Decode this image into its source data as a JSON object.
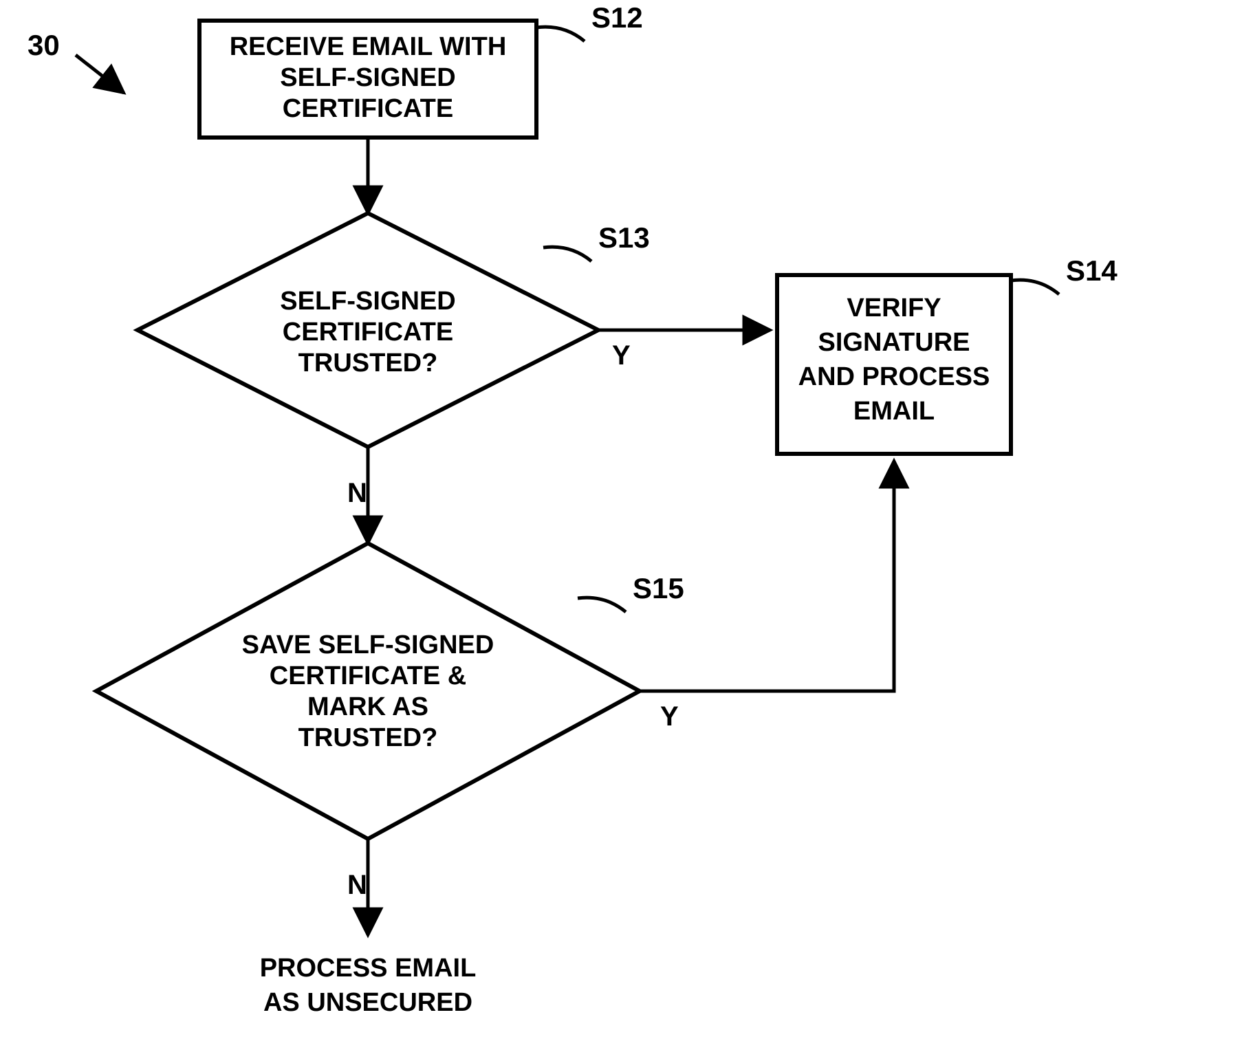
{
  "diagram": {
    "figure_label": "30",
    "nodes": {
      "s12": {
        "ref": "S12",
        "line1": "RECEIVE EMAIL WITH",
        "line2": "SELF-SIGNED",
        "line3": "CERTIFICATE"
      },
      "s13": {
        "ref": "S13",
        "line1": "SELF-SIGNED",
        "line2": "CERTIFICATE",
        "line3": "TRUSTED?"
      },
      "s14": {
        "ref": "S14",
        "line1": "VERIFY",
        "line2": "SIGNATURE",
        "line3": "AND PROCESS",
        "line4": "EMAIL"
      },
      "s15": {
        "ref": "S15",
        "line1": "SAVE SELF-SIGNED",
        "line2": "CERTIFICATE &",
        "line3": "MARK AS",
        "line4": "TRUSTED?"
      },
      "end": {
        "line1": "PROCESS EMAIL",
        "line2": "AS UNSECURED"
      }
    },
    "edges": {
      "s13_yes": "Y",
      "s13_no": "N",
      "s15_yes": "Y",
      "s15_no": "N"
    }
  }
}
